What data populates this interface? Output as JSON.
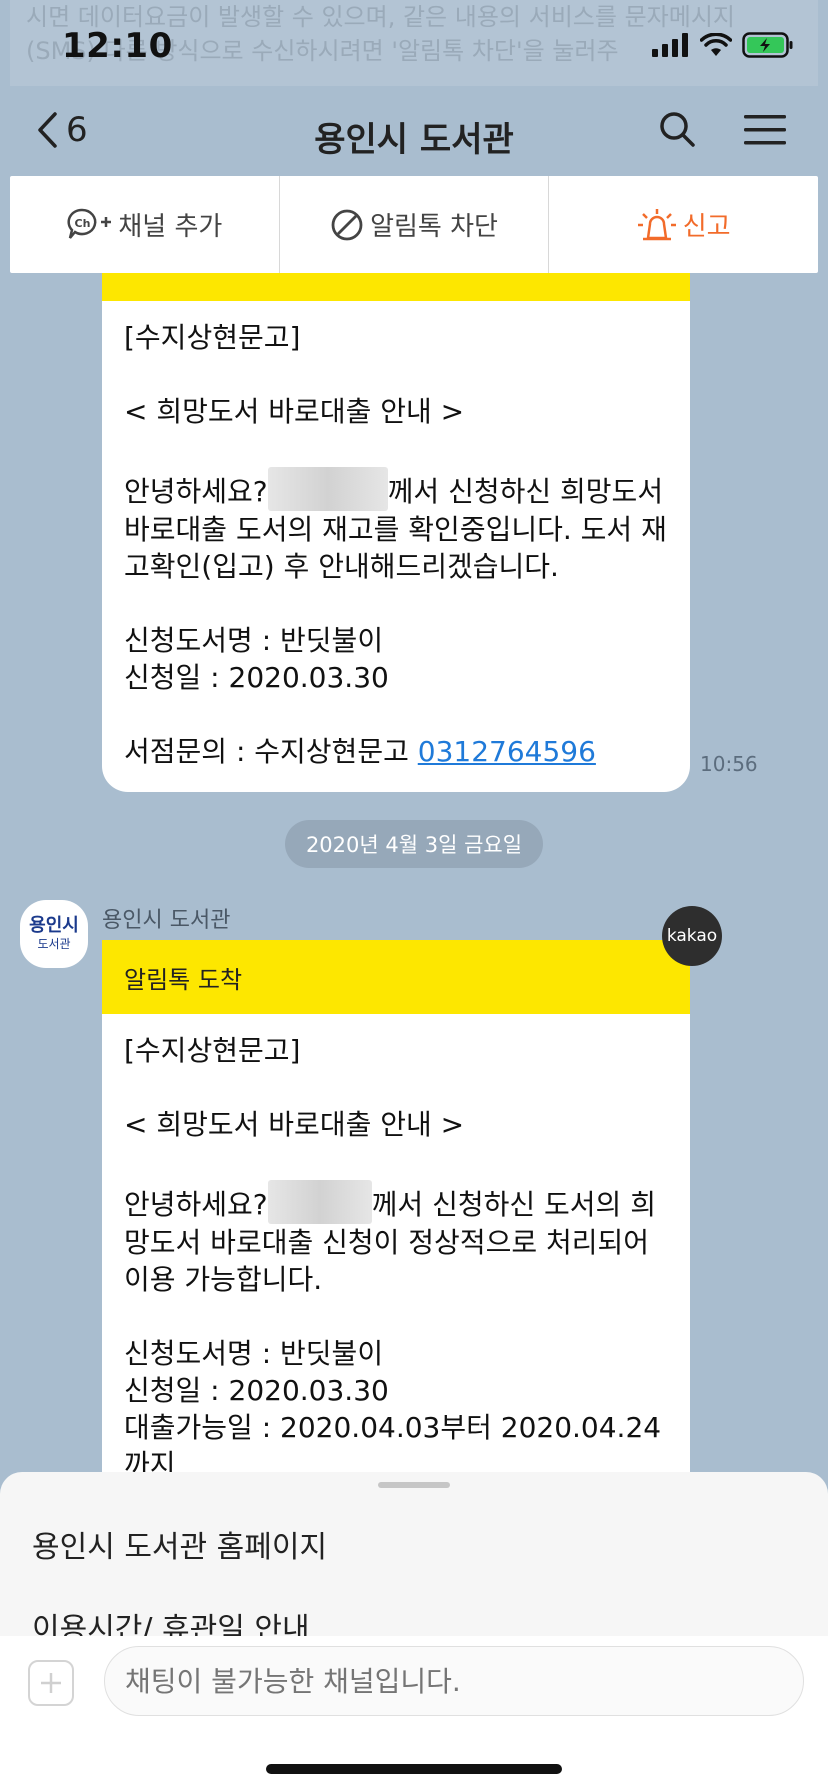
{
  "notice": {
    "line1": "시면 데이터요금이 발생할 수 있으며, 같은 내용의 서비스를 문자메시지",
    "line2": "(SMS) 다른 방식으로 수신하시려면 '알림톡 차단'을 눌러주"
  },
  "status": {
    "time": "12:10"
  },
  "header": {
    "back_count": "6",
    "title": "용인시 도서관"
  },
  "actions": {
    "add_channel": "채널 추가",
    "block_alimtalk": "알림톡 차단",
    "report": "신고"
  },
  "messages": [
    {
      "lines": [
        "[수지상현문고]",
        "",
        "< 희망도서 바로대출 안내 >",
        "",
        "안녕하세요?",
        "께서 신청하신 희망도서",
        "바로대출 도서의 재고를 확인중입니다. 도서 재",
        "고확인(입고) 후 안내해드리겠습니다.",
        "",
        "신청도서명 : 반딧불이",
        "신청일 : 2020.03.30",
        "",
        "서점문의 : 수지상현문고 "
      ],
      "phone": "0312764596",
      "time": "10:56"
    },
    {
      "header": "알림톡 도착",
      "lines": [
        "[수지상현문고]",
        "",
        "< 희망도서 바로대출 안내 >",
        "",
        "안녕하세요?",
        "께서 신청하신 도서의 희",
        "망도서 바로대출 신청이 정상적으로 처리되어",
        "이용 가능합니다.",
        "",
        "신청도서명 : 반딧불이",
        "신청일 : 2020.03.30",
        "대출가능일 : 2020.04.03부터 2020.04.24",
        "까지"
      ]
    }
  ],
  "date_divider": "2020년 4월 3일 금요일",
  "sender": {
    "name": "용인시 도서관",
    "avatar_main": "용인시",
    "avatar_sub": "도서관"
  },
  "kakao_badge": "kakao",
  "sheet": {
    "items": [
      "용인시 도서관 홈페이지",
      "이용시간/ 휴관일 안내"
    ]
  },
  "input": {
    "placeholder": "채팅이 불가능한 채널입니다."
  },
  "colors": {
    "background": "#a9bdcf",
    "header_yellow": "#fde700",
    "report": "#f26b2a",
    "link": "#1f7ad9"
  }
}
